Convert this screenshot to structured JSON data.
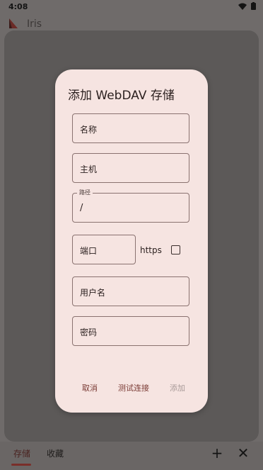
{
  "status_bar": {
    "time": "4:08"
  },
  "app_bar": {
    "title": "Iris"
  },
  "bottom_nav": {
    "tabs": [
      {
        "label": "存储"
      },
      {
        "label": "收藏"
      }
    ],
    "add_icon": "plus-icon",
    "close_icon": "close-icon"
  },
  "dialog": {
    "title": "添加 WebDAV 存储",
    "fields": {
      "name": {
        "placeholder": "名称"
      },
      "host": {
        "placeholder": "主机"
      },
      "path": {
        "label": "路径",
        "value": "/"
      },
      "port": {
        "placeholder": "端口"
      },
      "username": {
        "placeholder": "用户名"
      },
      "password": {
        "placeholder": "密码"
      }
    },
    "https": {
      "label": "https",
      "checked": false
    },
    "actions": {
      "cancel": "取消",
      "test": "测试连接",
      "add": "添加"
    }
  },
  "colors": {
    "accent": "#7a3a34",
    "dialog_bg": "#f6e4e1",
    "scrim": "#6f6b6a"
  }
}
